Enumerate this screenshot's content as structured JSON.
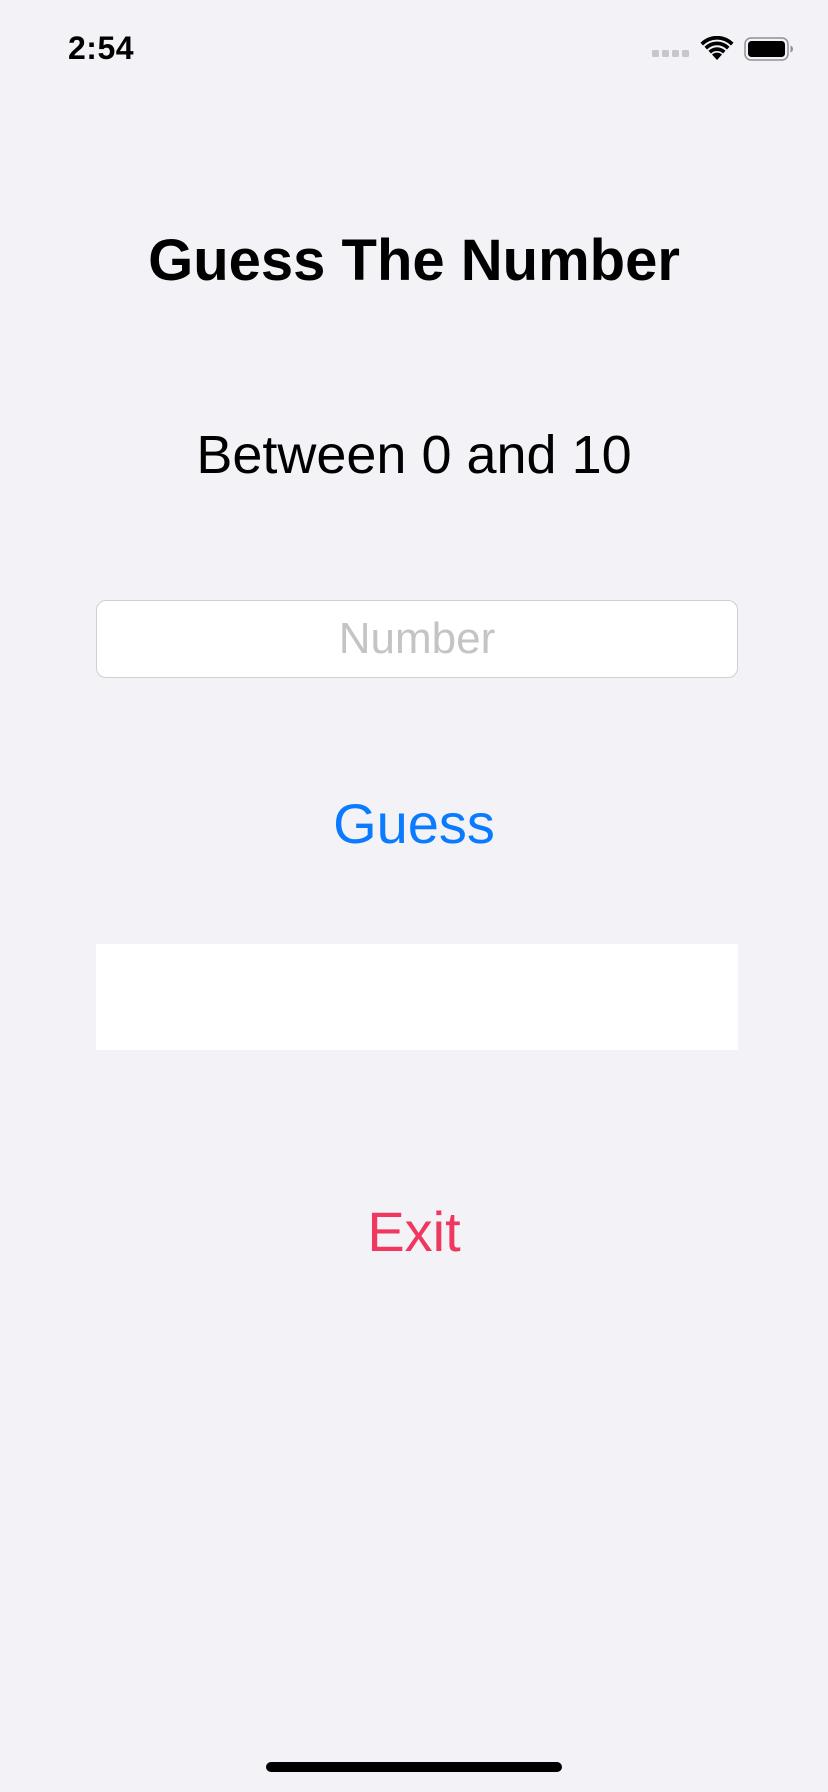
{
  "status_bar": {
    "time": "2:54",
    "icons": [
      "signal-icon",
      "wifi-icon",
      "battery-icon"
    ]
  },
  "title": "Guess The Number",
  "subtitle": "Between 0 and 10",
  "number_input": {
    "value": "",
    "placeholder": "Number"
  },
  "guess_button": {
    "label": "Guess",
    "color": "#0a7aff"
  },
  "result_text": "",
  "exit_button": {
    "label": "Exit",
    "color": "#f0375f"
  },
  "colors": {
    "background": "#f2f2f7",
    "placeholder": "#c4c4c7"
  }
}
